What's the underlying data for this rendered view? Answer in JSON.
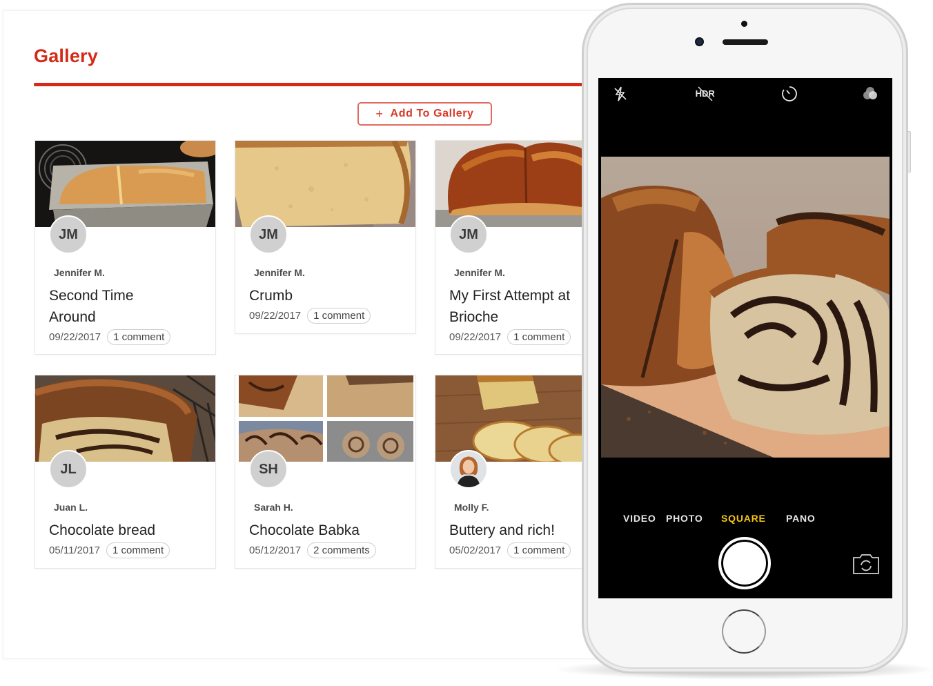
{
  "gallery": {
    "title": "Gallery",
    "add_button": {
      "icon": "plus-icon",
      "plus": "+",
      "label": "Add To Gallery"
    },
    "accent_color": "#d42a17",
    "cards": [
      {
        "initials": "JM",
        "author": "Jennifer M.",
        "title": "Second Time Around",
        "date": "09/22/2017",
        "comments": "1 comment",
        "image": "bread-loaf-in-pan"
      },
      {
        "initials": "JM",
        "author": "Jennifer M.",
        "title": "Crumb",
        "date": "09/22/2017",
        "comments": "1 comment",
        "image": "bread-crumb-slice"
      },
      {
        "initials": "JM",
        "author": "Jennifer M.",
        "title": "My First Attempt at Brioche",
        "date": "09/22/2017",
        "comments": "1 comment",
        "image": "brioche-loaf"
      },
      {
        "initials": "JL",
        "author": "Juan L.",
        "title": "Chocolate bread",
        "date": "05/11/2017",
        "comments": "1 comment",
        "image": "chocolate-bread"
      },
      {
        "initials": "SH",
        "author": "Sarah H.",
        "title": "Chocolate Babka",
        "date": "05/12/2017",
        "comments": "2 comments",
        "image": "babka-collage"
      },
      {
        "initials": "",
        "author": "Molly F.",
        "title": "Buttery and rich!",
        "date": "05/02/2017",
        "comments": "1 comment",
        "image": "sliced-pound-cake",
        "avatar_photo": true
      }
    ]
  },
  "camera": {
    "top_icons": [
      "flash-off-icon",
      "hdr-off-icon",
      "timer-icon",
      "filters-icon"
    ],
    "hdr_label": "HDR",
    "modes": [
      {
        "label": "VIDEO",
        "active": false
      },
      {
        "label": "PHOTO",
        "active": false
      },
      {
        "label": "SQUARE",
        "active": true
      },
      {
        "label": "PANO",
        "active": false
      }
    ],
    "active_mode_color": "#f5c518",
    "viewfinder_subject": "babka-loaves-on-cutting-board"
  }
}
